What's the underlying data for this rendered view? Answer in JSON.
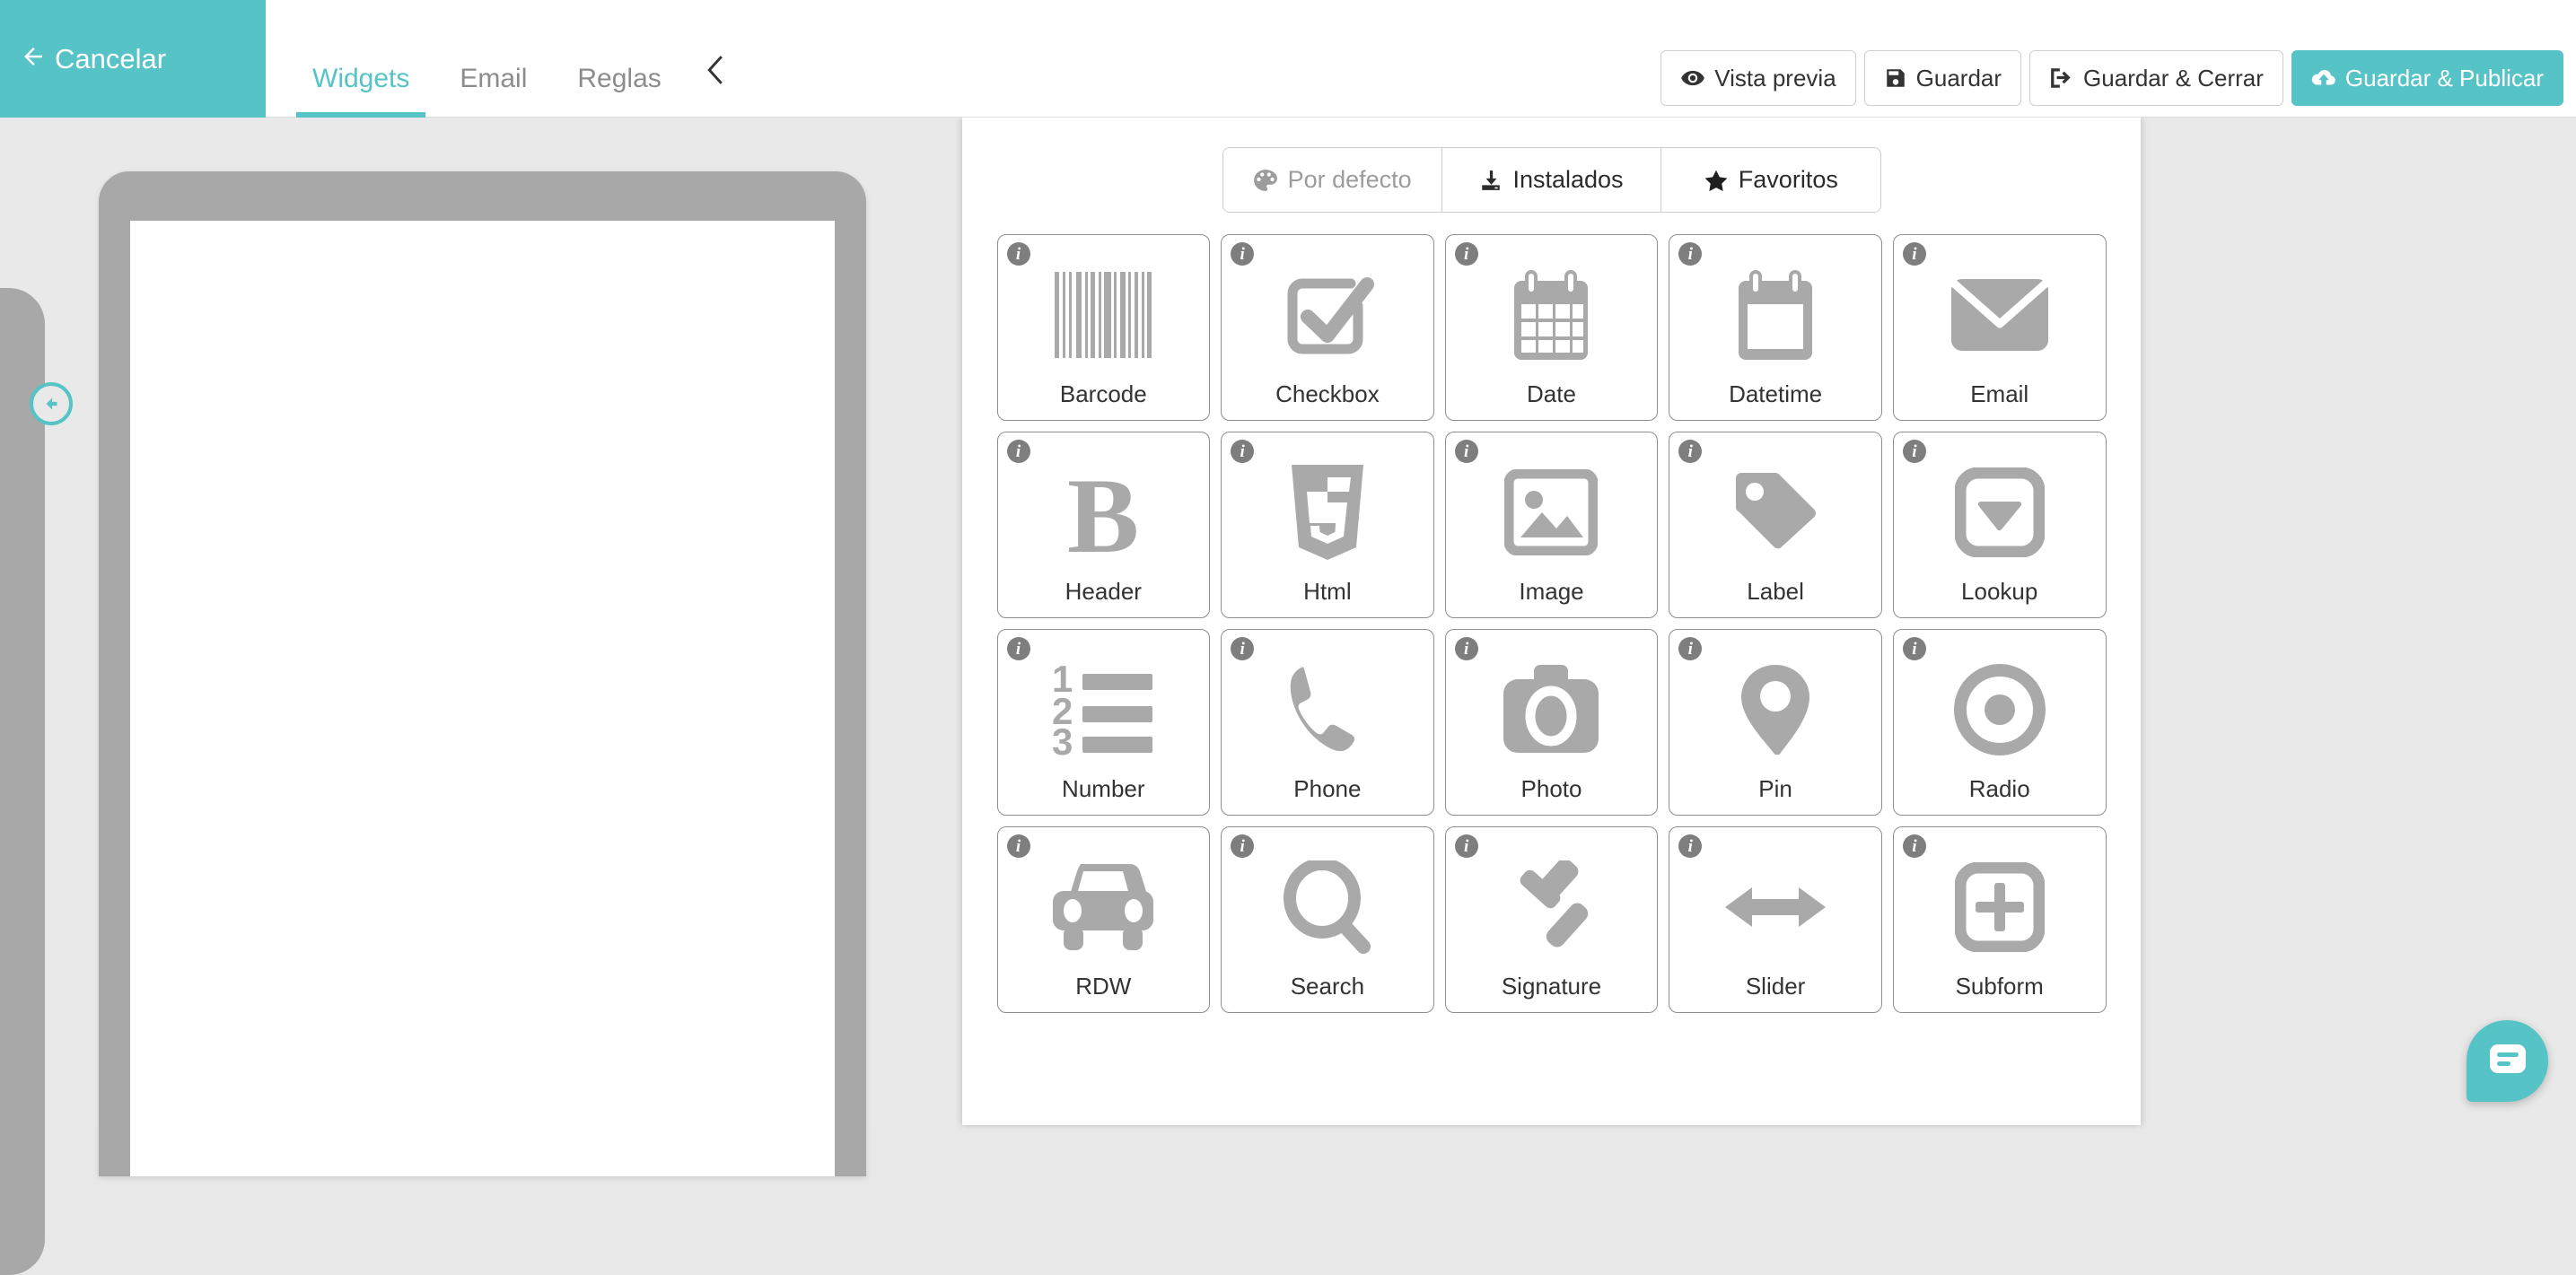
{
  "topbar": {
    "cancel_label": "Cancelar",
    "cancel_icon": "arrow-left-icon",
    "tabs": [
      {
        "label": "Widgets",
        "active": true
      },
      {
        "label": "Email",
        "active": false
      },
      {
        "label": "Reglas",
        "active": false
      }
    ],
    "collapse_chevron": "‹",
    "actions": [
      {
        "label": "Vista previa",
        "icon": "eye-icon",
        "primary": false
      },
      {
        "label": "Guardar",
        "icon": "floppy-disk-icon",
        "primary": false
      },
      {
        "label": "Guardar & Cerrar",
        "icon": "sign-out-icon",
        "primary": false
      },
      {
        "label": "Guardar & Publicar",
        "icon": "cloud-upload-icon",
        "primary": true
      }
    ]
  },
  "colors": {
    "accent": "#56c3c6",
    "workspace_bg": "#e9e9e9",
    "device_frame": "#a8a8a8",
    "icon_gray": "#a9a9a9",
    "card_border": "#8e8e8e",
    "text": "#333333",
    "muted_text": "#9c9c9c"
  },
  "canvas": {
    "collapse_button_icon": "arrow-circle-left-icon",
    "device_name": "tablet-preview"
  },
  "widget_panel": {
    "filters": [
      {
        "label": "Por defecto",
        "icon": "palette-icon",
        "muted": true
      },
      {
        "label": "Instalados",
        "icon": "download-icon",
        "muted": false
      },
      {
        "label": "Favoritos",
        "icon": "star-icon",
        "muted": false
      }
    ],
    "widgets": [
      {
        "label": "Barcode",
        "icon": "barcode-icon"
      },
      {
        "label": "Checkbox",
        "icon": "checkbox-icon"
      },
      {
        "label": "Date",
        "icon": "calendar-icon"
      },
      {
        "label": "Datetime",
        "icon": "calendar-blank-icon"
      },
      {
        "label": "Email",
        "icon": "envelope-icon"
      },
      {
        "label": "Header",
        "icon": "bold-b-icon"
      },
      {
        "label": "Html",
        "icon": "html5-icon"
      },
      {
        "label": "Image",
        "icon": "picture-icon"
      },
      {
        "label": "Label",
        "icon": "tag-icon"
      },
      {
        "label": "Lookup",
        "icon": "dropdown-icon"
      },
      {
        "label": "Number",
        "icon": "numbered-list-icon"
      },
      {
        "label": "Phone",
        "icon": "phone-icon"
      },
      {
        "label": "Photo",
        "icon": "camera-icon"
      },
      {
        "label": "Pin",
        "icon": "map-pin-icon"
      },
      {
        "label": "Radio",
        "icon": "radio-button-icon"
      },
      {
        "label": "RDW",
        "icon": "car-icon"
      },
      {
        "label": "Search",
        "icon": "magnifier-icon"
      },
      {
        "label": "Signature",
        "icon": "gavel-icon"
      },
      {
        "label": "Slider",
        "icon": "arrows-horizontal-icon"
      },
      {
        "label": "Subform",
        "icon": "plus-square-icon"
      }
    ],
    "info_badge_glyph": "i"
  },
  "chat": {
    "icon": "chat-bubble-icon"
  }
}
